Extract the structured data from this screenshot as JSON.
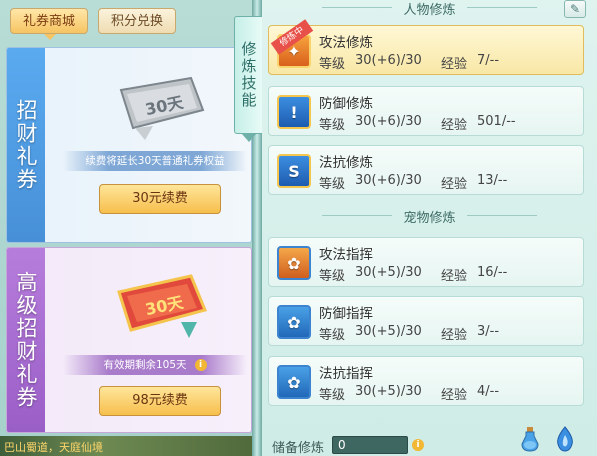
{
  "left": {
    "tabs": [
      {
        "label": "礼券商城",
        "active": true
      },
      {
        "label": "积分兑换",
        "active": false
      }
    ],
    "cards": [
      {
        "side_label": "招财礼券",
        "ticket_text": "30天",
        "strip_text": "续费将延长30天普通礼券权益",
        "button_label": "30元续费"
      },
      {
        "side_label": "高级招财礼券",
        "ticket_text": "30天",
        "strip_text": "有效期剩余105天",
        "button_label": "98元续费"
      }
    ],
    "scene_text": "巴山蜀道，天庭仙境"
  },
  "skill_tab_label": "修炼技能",
  "right": {
    "sections": [
      {
        "title": "人物修炼",
        "rows": [
          {
            "name": "攻法修炼",
            "level_label": "等级",
            "level": "30(+6)/30",
            "exp_label": "经验",
            "exp": "7/--",
            "badge": "修炼中",
            "active": true
          },
          {
            "name": "防御修炼",
            "level_label": "等级",
            "level": "30(+6)/30",
            "exp_label": "经验",
            "exp": "501/--"
          },
          {
            "name": "法抗修炼",
            "level_label": "等级",
            "level": "30(+6)/30",
            "exp_label": "经验",
            "exp": "13/--"
          }
        ]
      },
      {
        "title": "宠物修炼",
        "rows": [
          {
            "name": "攻法指挥",
            "level_label": "等级",
            "level": "30(+5)/30",
            "exp_label": "经验",
            "exp": "16/--"
          },
          {
            "name": "防御指挥",
            "level_label": "等级",
            "level": "30(+5)/30",
            "exp_label": "经验",
            "exp": "3/--"
          },
          {
            "name": "法抗指挥",
            "level_label": "等级",
            "level": "30(+5)/30",
            "exp_label": "经验",
            "exp": "4/--"
          }
        ]
      }
    ],
    "store": {
      "label": "储备修炼",
      "value": "0"
    }
  },
  "colors": {
    "accent_gold": "#f6bf4d",
    "active_row": "#f8e7a6",
    "blue_card": "#4790d8",
    "purple_card": "#9a5ec7",
    "badge_red": "#e8514a"
  }
}
